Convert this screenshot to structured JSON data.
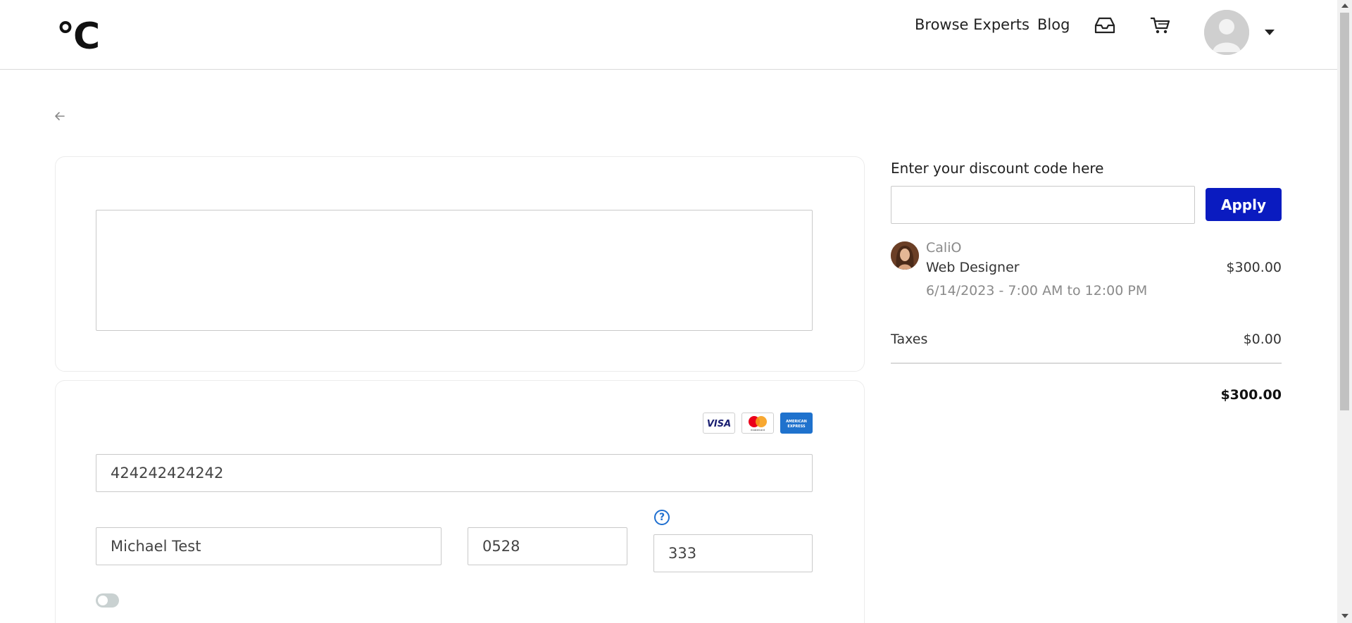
{
  "header": {
    "logo": "°C",
    "nav": {
      "browse_experts": "Browse Experts",
      "blog": "Blog"
    },
    "icons": {
      "inbox": "inbox-icon",
      "cart": "cart-icon",
      "avatar": "avatar",
      "menu": "chevron-down-icon"
    }
  },
  "back": {
    "icon": "arrow-left-icon"
  },
  "notes": {
    "value": ""
  },
  "payment": {
    "card_brands": [
      "VISA",
      "mastercard",
      "AMERICAN EXPRESS"
    ],
    "card_number": "424242424242",
    "cardholder_name": "Michael Test",
    "expiry": "0528",
    "cvc": "333",
    "cvc_help": "?",
    "toggle_on": false
  },
  "summary": {
    "discount_label": "Enter your discount code here",
    "discount_value": "",
    "apply_label": "Apply",
    "expert": {
      "name": "CaliO",
      "role": "Web Designer",
      "price": "$300.00",
      "time": "6/14/2023 - 7:00 AM to 12:00 PM"
    },
    "taxes_label": "Taxes",
    "taxes_value": "$0.00",
    "total_value": "$300.00"
  },
  "colors": {
    "apply_button": "#0a1bc0",
    "help_icon": "#1f6fd0",
    "toggle_off": "#c9d1d1"
  }
}
